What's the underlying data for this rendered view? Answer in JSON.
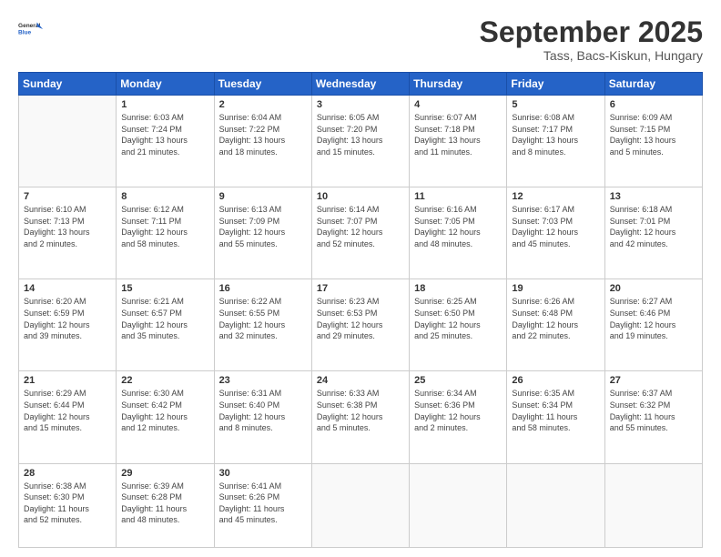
{
  "logo": {
    "line1": "General",
    "line2": "Blue"
  },
  "title": "September 2025",
  "subtitle": "Tass, Bacs-Kiskun, Hungary",
  "weekdays": [
    "Sunday",
    "Monday",
    "Tuesday",
    "Wednesday",
    "Thursday",
    "Friday",
    "Saturday"
  ],
  "days": [
    {
      "num": "",
      "info": ""
    },
    {
      "num": "1",
      "info": "Sunrise: 6:03 AM\nSunset: 7:24 PM\nDaylight: 13 hours\nand 21 minutes."
    },
    {
      "num": "2",
      "info": "Sunrise: 6:04 AM\nSunset: 7:22 PM\nDaylight: 13 hours\nand 18 minutes."
    },
    {
      "num": "3",
      "info": "Sunrise: 6:05 AM\nSunset: 7:20 PM\nDaylight: 13 hours\nand 15 minutes."
    },
    {
      "num": "4",
      "info": "Sunrise: 6:07 AM\nSunset: 7:18 PM\nDaylight: 13 hours\nand 11 minutes."
    },
    {
      "num": "5",
      "info": "Sunrise: 6:08 AM\nSunset: 7:17 PM\nDaylight: 13 hours\nand 8 minutes."
    },
    {
      "num": "6",
      "info": "Sunrise: 6:09 AM\nSunset: 7:15 PM\nDaylight: 13 hours\nand 5 minutes."
    },
    {
      "num": "7",
      "info": "Sunrise: 6:10 AM\nSunset: 7:13 PM\nDaylight: 13 hours\nand 2 minutes."
    },
    {
      "num": "8",
      "info": "Sunrise: 6:12 AM\nSunset: 7:11 PM\nDaylight: 12 hours\nand 58 minutes."
    },
    {
      "num": "9",
      "info": "Sunrise: 6:13 AM\nSunset: 7:09 PM\nDaylight: 12 hours\nand 55 minutes."
    },
    {
      "num": "10",
      "info": "Sunrise: 6:14 AM\nSunset: 7:07 PM\nDaylight: 12 hours\nand 52 minutes."
    },
    {
      "num": "11",
      "info": "Sunrise: 6:16 AM\nSunset: 7:05 PM\nDaylight: 12 hours\nand 48 minutes."
    },
    {
      "num": "12",
      "info": "Sunrise: 6:17 AM\nSunset: 7:03 PM\nDaylight: 12 hours\nand 45 minutes."
    },
    {
      "num": "13",
      "info": "Sunrise: 6:18 AM\nSunset: 7:01 PM\nDaylight: 12 hours\nand 42 minutes."
    },
    {
      "num": "14",
      "info": "Sunrise: 6:20 AM\nSunset: 6:59 PM\nDaylight: 12 hours\nand 39 minutes."
    },
    {
      "num": "15",
      "info": "Sunrise: 6:21 AM\nSunset: 6:57 PM\nDaylight: 12 hours\nand 35 minutes."
    },
    {
      "num": "16",
      "info": "Sunrise: 6:22 AM\nSunset: 6:55 PM\nDaylight: 12 hours\nand 32 minutes."
    },
    {
      "num": "17",
      "info": "Sunrise: 6:23 AM\nSunset: 6:53 PM\nDaylight: 12 hours\nand 29 minutes."
    },
    {
      "num": "18",
      "info": "Sunrise: 6:25 AM\nSunset: 6:50 PM\nDaylight: 12 hours\nand 25 minutes."
    },
    {
      "num": "19",
      "info": "Sunrise: 6:26 AM\nSunset: 6:48 PM\nDaylight: 12 hours\nand 22 minutes."
    },
    {
      "num": "20",
      "info": "Sunrise: 6:27 AM\nSunset: 6:46 PM\nDaylight: 12 hours\nand 19 minutes."
    },
    {
      "num": "21",
      "info": "Sunrise: 6:29 AM\nSunset: 6:44 PM\nDaylight: 12 hours\nand 15 minutes."
    },
    {
      "num": "22",
      "info": "Sunrise: 6:30 AM\nSunset: 6:42 PM\nDaylight: 12 hours\nand 12 minutes."
    },
    {
      "num": "23",
      "info": "Sunrise: 6:31 AM\nSunset: 6:40 PM\nDaylight: 12 hours\nand 8 minutes."
    },
    {
      "num": "24",
      "info": "Sunrise: 6:33 AM\nSunset: 6:38 PM\nDaylight: 12 hours\nand 5 minutes."
    },
    {
      "num": "25",
      "info": "Sunrise: 6:34 AM\nSunset: 6:36 PM\nDaylight: 12 hours\nand 2 minutes."
    },
    {
      "num": "26",
      "info": "Sunrise: 6:35 AM\nSunset: 6:34 PM\nDaylight: 11 hours\nand 58 minutes."
    },
    {
      "num": "27",
      "info": "Sunrise: 6:37 AM\nSunset: 6:32 PM\nDaylight: 11 hours\nand 55 minutes."
    },
    {
      "num": "28",
      "info": "Sunrise: 6:38 AM\nSunset: 6:30 PM\nDaylight: 11 hours\nand 52 minutes."
    },
    {
      "num": "29",
      "info": "Sunrise: 6:39 AM\nSunset: 6:28 PM\nDaylight: 11 hours\nand 48 minutes."
    },
    {
      "num": "30",
      "info": "Sunrise: 6:41 AM\nSunset: 6:26 PM\nDaylight: 11 hours\nand 45 minutes."
    },
    {
      "num": "",
      "info": ""
    },
    {
      "num": "",
      "info": ""
    },
    {
      "num": "",
      "info": ""
    },
    {
      "num": "",
      "info": ""
    }
  ]
}
